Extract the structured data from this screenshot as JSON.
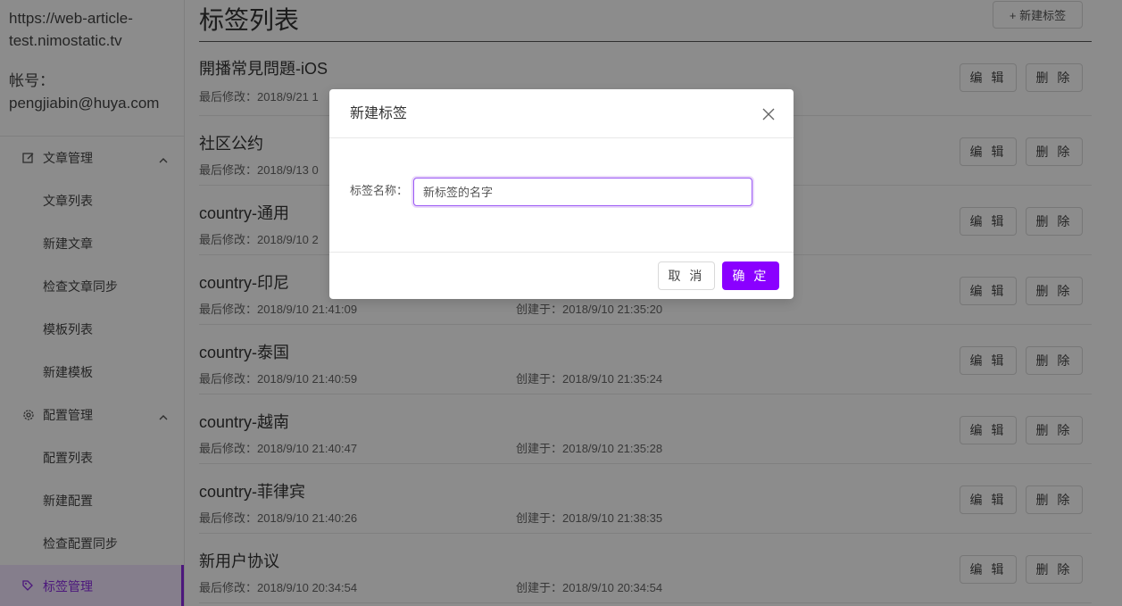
{
  "sidebar": {
    "site_url": "https://web-article-test.nimostatic.tv",
    "site_url_line1": "https://web-article-",
    "site_url_line2": "test.nimostatic.tv",
    "account_label": "帐号：",
    "account_email": "pengjiabin@huya.com",
    "groups": [
      {
        "title": "文章管理",
        "icon": "edit-icon",
        "items": [
          {
            "label": "文章列表"
          },
          {
            "label": "新建文章"
          },
          {
            "label": "检查文章同步"
          },
          {
            "label": "模板列表"
          },
          {
            "label": "新建模板"
          }
        ]
      },
      {
        "title": "配置管理",
        "icon": "gear-icon",
        "items": [
          {
            "label": "配置列表"
          },
          {
            "label": "新建配置"
          },
          {
            "label": "检查配置同步"
          }
        ]
      }
    ],
    "active_item": {
      "label": "标签管理",
      "icon": "tag-icon"
    }
  },
  "main": {
    "title": "标签列表",
    "new_button": "+ 新建标签",
    "edit_label": "编 辑",
    "delete_label": "删 除",
    "tags": [
      {
        "name": "開播常見問題-iOS",
        "modified": "最后修改：2018/9/21 1",
        "created": ""
      },
      {
        "name": "社区公约",
        "modified": "最后修改：2018/9/13 0",
        "created": ""
      },
      {
        "name": "country-通用",
        "modified": "最后修改：2018/9/10 2",
        "created": ""
      },
      {
        "name": "country-印尼",
        "modified": "最后修改：2018/9/10 21:41:09",
        "created": "创建于：2018/9/10 21:35:20"
      },
      {
        "name": "country-泰国",
        "modified": "最后修改：2018/9/10 21:40:59",
        "created": "创建于：2018/9/10 21:35:24"
      },
      {
        "name": "country-越南",
        "modified": "最后修改：2018/9/10 21:40:47",
        "created": "创建于：2018/9/10 21:35:28"
      },
      {
        "name": "country-菲律宾",
        "modified": "最后修改：2018/9/10 21:40:26",
        "created": "创建于：2018/9/10 21:38:35"
      },
      {
        "name": "新用户协议",
        "modified": "最后修改：2018/9/10 20:34:54",
        "created": "创建于：2018/9/10 20:34:54"
      }
    ]
  },
  "modal": {
    "title": "新建标签",
    "field_label": "标签名称：",
    "field_value": "",
    "field_placeholder": "新标签的名字",
    "cancel_label": "取 消",
    "ok_label": "确 定"
  },
  "colors": {
    "accent": "#8a00ff",
    "overlay": "rgba(0,0,0,0.45)"
  }
}
